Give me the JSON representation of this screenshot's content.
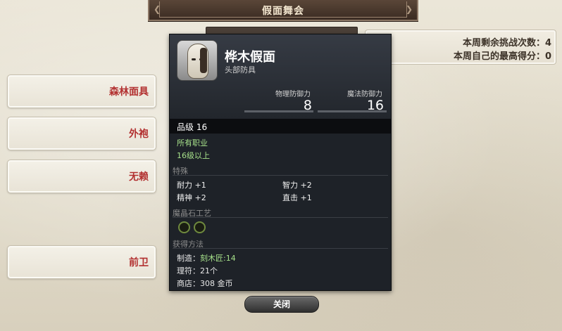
{
  "window": {
    "title": "假面舞会"
  },
  "left_options": [
    {
      "label": "森林面具"
    },
    {
      "label": "外袍"
    },
    {
      "label": "无赖"
    },
    {
      "label": "前卫"
    }
  ],
  "info": {
    "weekly_remaining": "本周剩余挑战次数：4",
    "weekly_best": "本周自己的最高得分：0"
  },
  "tooltip": {
    "icon": "mask-icon",
    "name": "桦木假面",
    "slot": "头部防具",
    "physical_def_label": "物理防御力",
    "physical_def": "8",
    "magic_def_label": "魔法防御力",
    "magic_def": "16",
    "item_level": "品级 16",
    "class_req": "所有职业",
    "level_req": "16级以上",
    "section_bonus": "特殊",
    "stats": [
      "耐力 +1",
      "智力 +2",
      "精神 +2",
      "直击 +1"
    ],
    "section_materia": "魔晶石工艺",
    "materia_slots": 2,
    "section_acquire": "获得方法",
    "craft_label": "制造：",
    "craft_value": "刻木匠:14",
    "repair": "理符：21个",
    "shop": "商店：308 金币"
  },
  "close_button": {
    "label": "关闭"
  }
}
